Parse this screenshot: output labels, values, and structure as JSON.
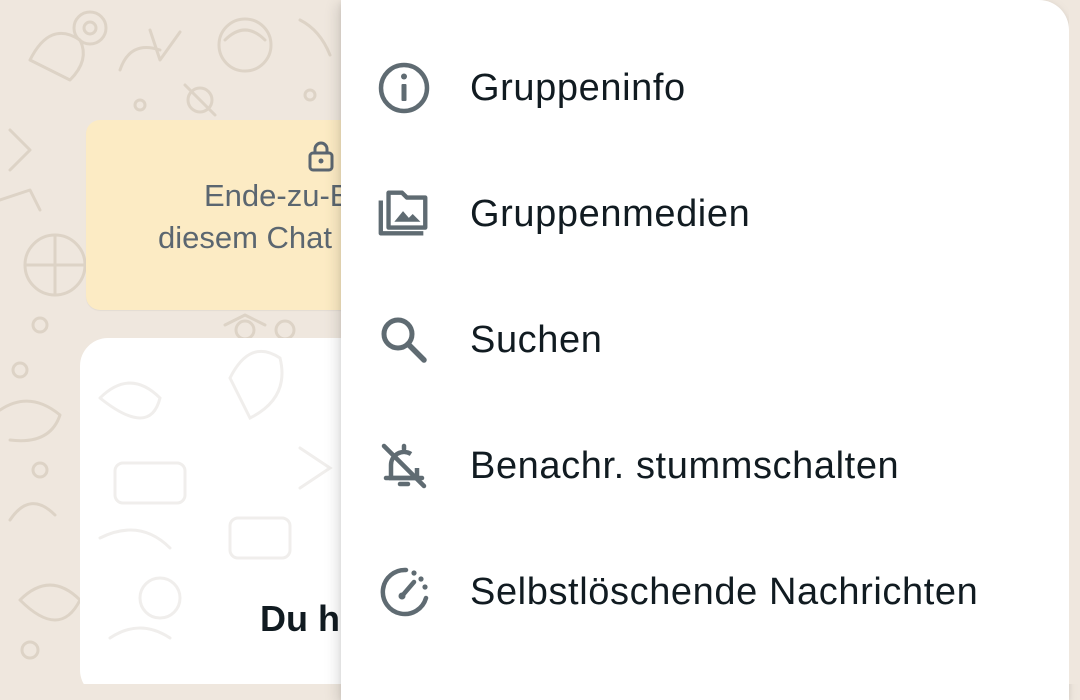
{
  "chat": {
    "encryption_notice": {
      "line1": "Ende-zu-E",
      "line2": "diesem Chat"
    },
    "intro_card": {
      "heading": "Du h"
    }
  },
  "menu": {
    "items": [
      {
        "label": "Gruppeninfo",
        "icon": "info-icon"
      },
      {
        "label": "Gruppenmedien",
        "icon": "media-library-icon"
      },
      {
        "label": "Suchen",
        "icon": "search-icon"
      },
      {
        "label": "Benachr. stummschalten",
        "icon": "bell-off-icon"
      },
      {
        "label": "Selbstlöschende Nachrichten",
        "icon": "disappearing-timer-icon"
      }
    ]
  },
  "colors": {
    "chat_background": "#efe7de",
    "notice_background": "#fcebc4",
    "menu_background": "#ffffff",
    "icon_color": "#5f6b72",
    "text_color": "#111b21"
  }
}
